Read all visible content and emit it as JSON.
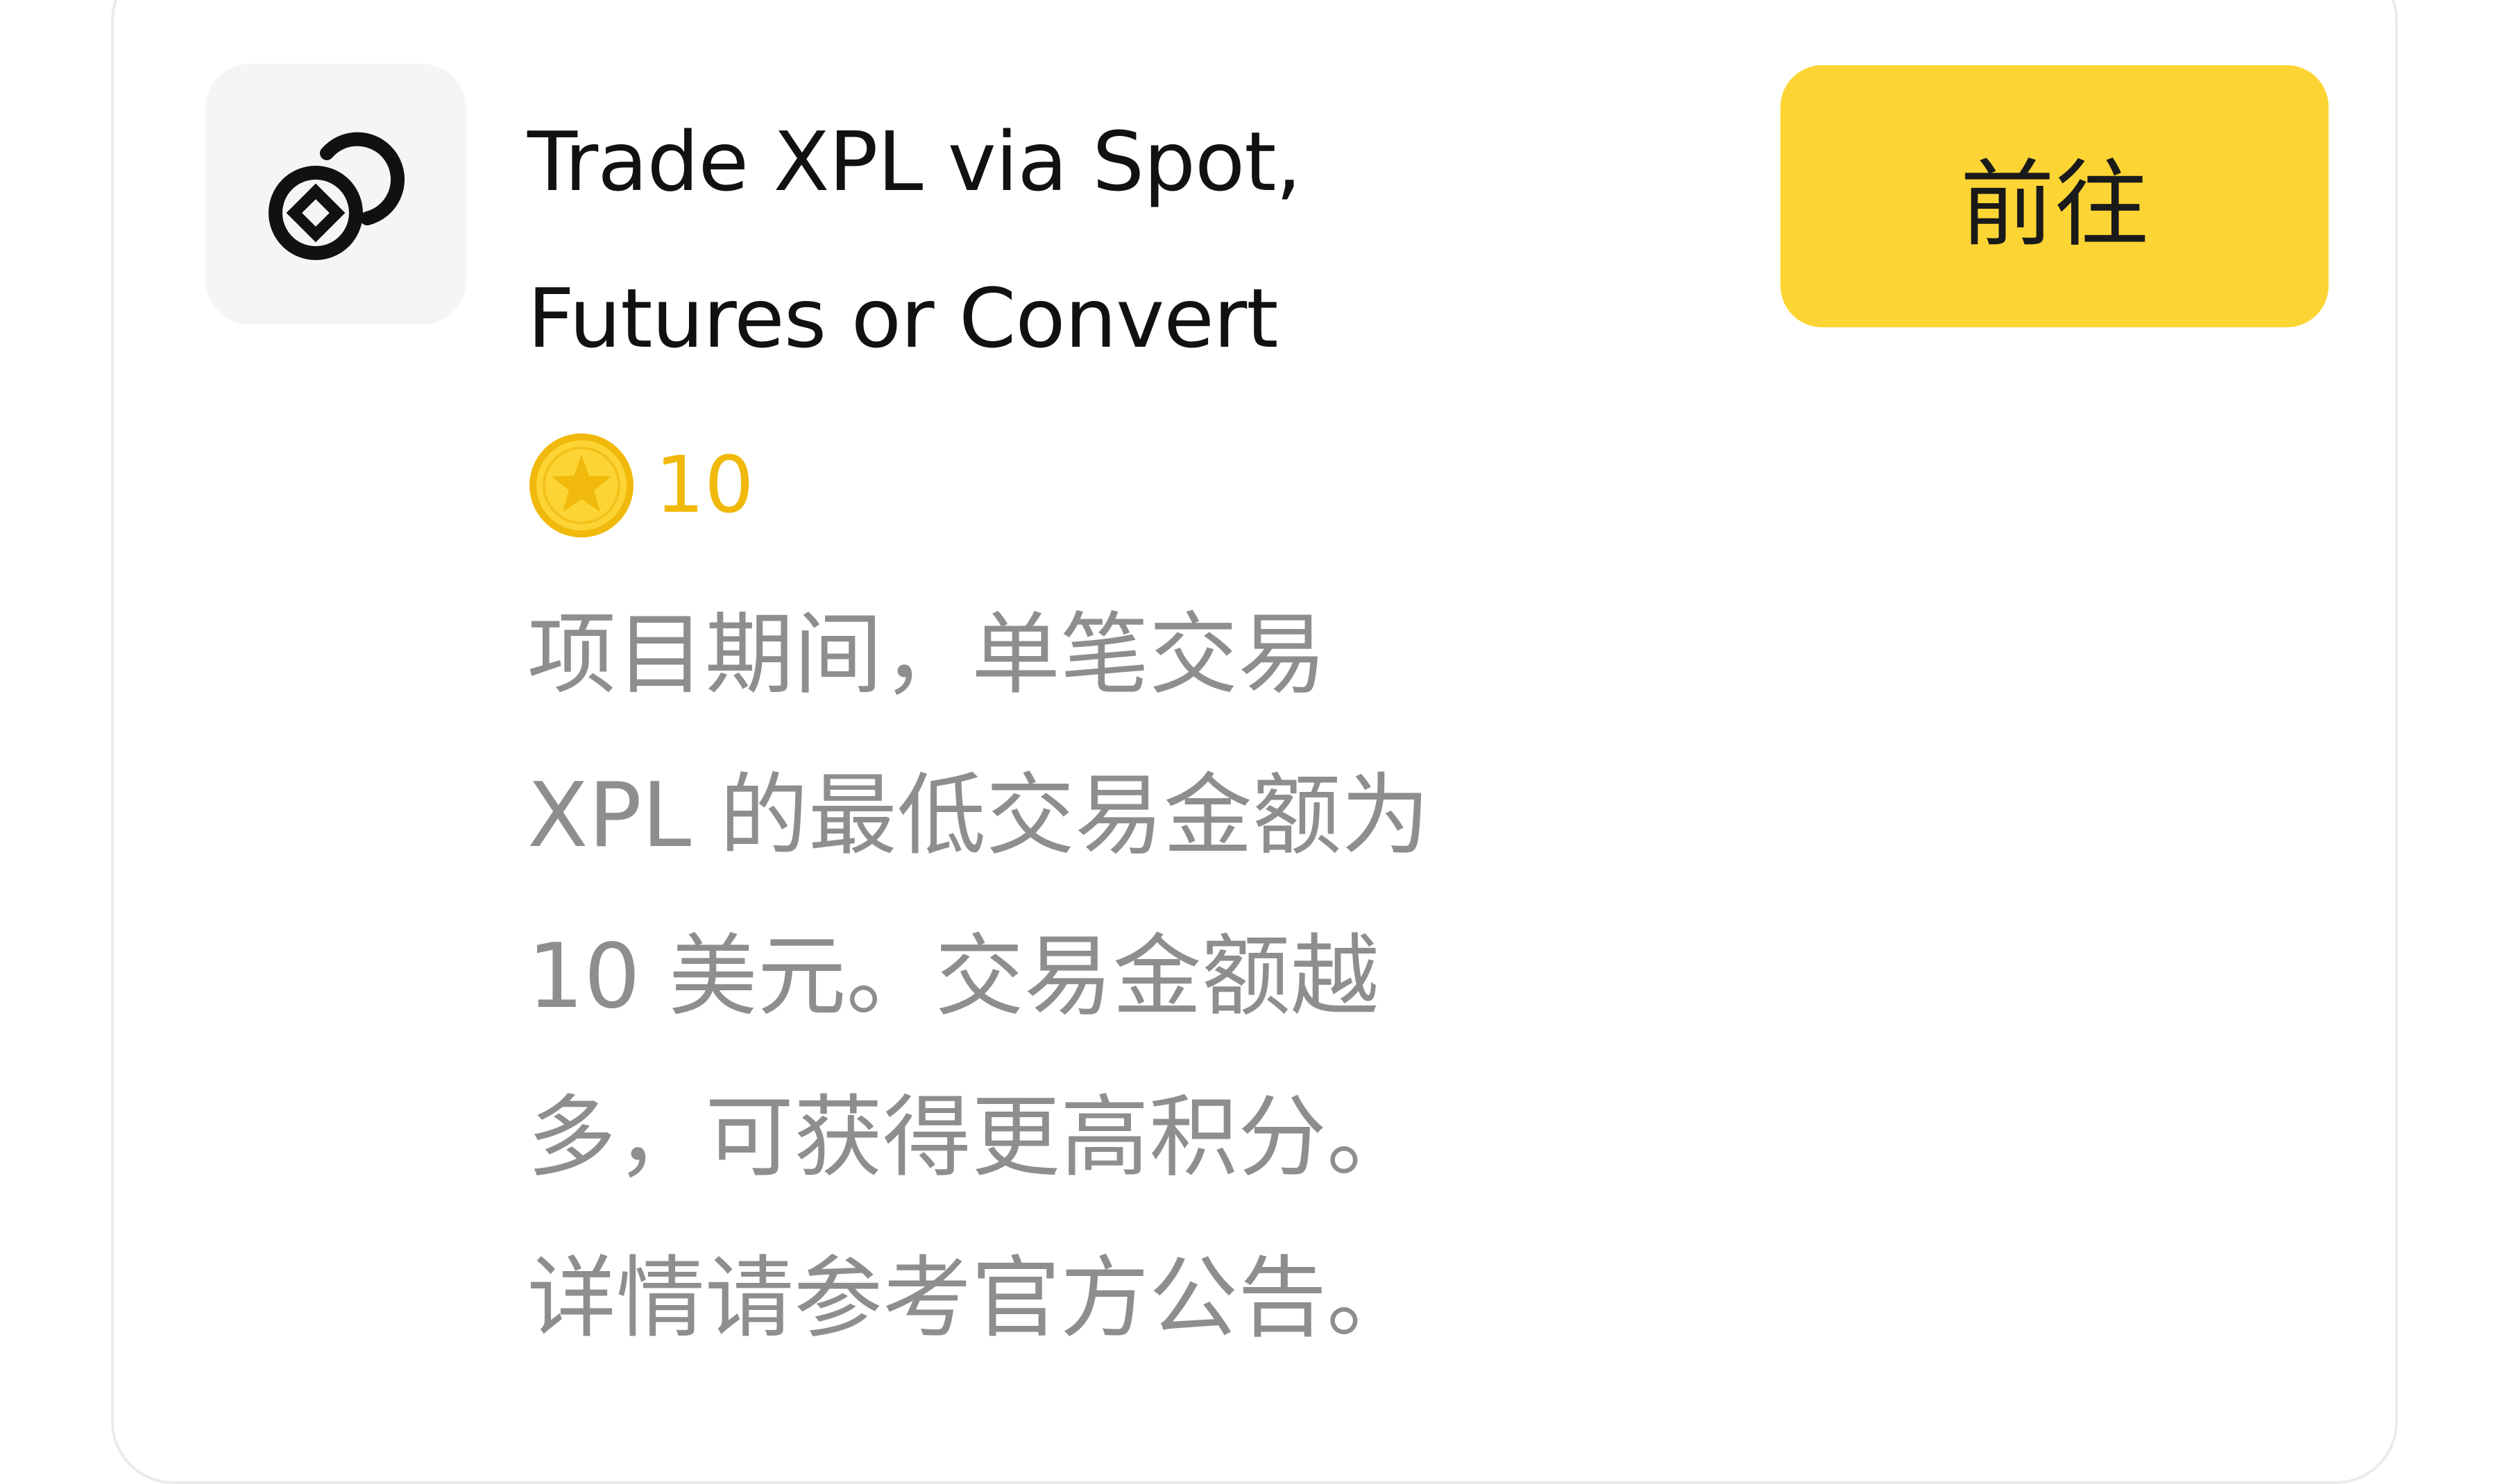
{
  "task": {
    "icon": "coins-exchange-icon",
    "title_lines": [
      "Trade XPL via Spot,",
      "Futures or Convert"
    ],
    "go_label": "前往",
    "points": "10",
    "points_icon": "star-coin-icon",
    "description_lines": [
      "项目期间，单笔交易",
      "XPL 的最低交易金额为",
      "10 美元。交易金额越",
      "多，可获得更高积分。",
      "详情请参考官方公告。"
    ]
  },
  "colors": {
    "accent": "#fcd535",
    "points": "#f0b90b",
    "title": "#111111",
    "description": "#8e8e8e"
  }
}
